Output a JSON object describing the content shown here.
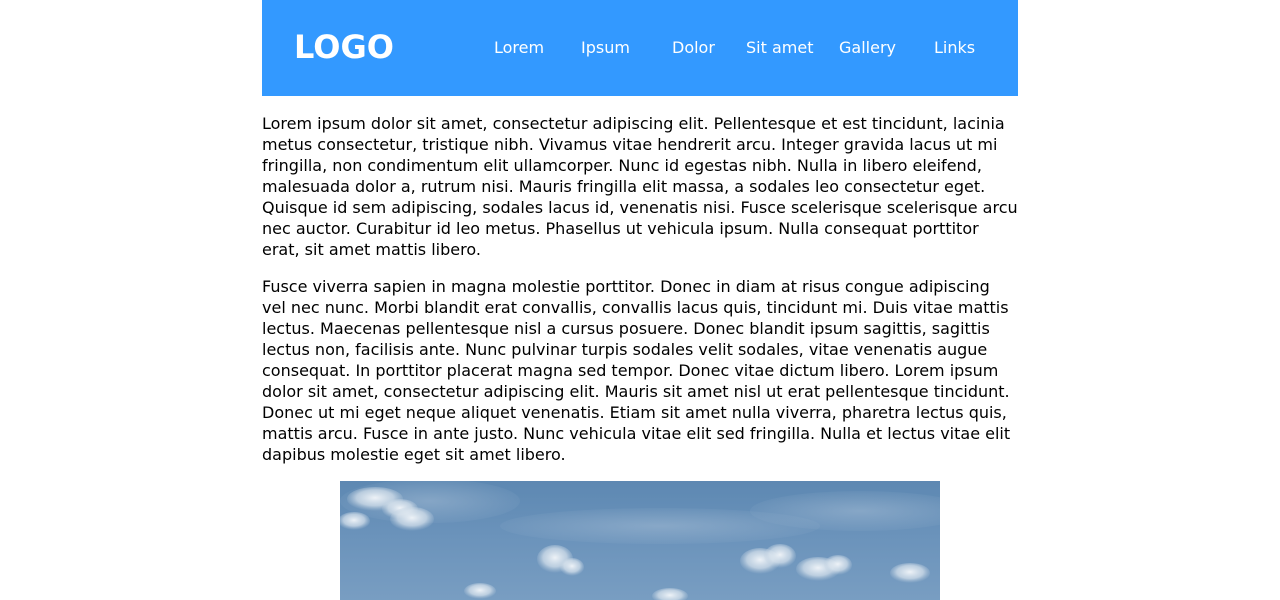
{
  "header": {
    "logo": "LOGO",
    "nav": [
      "Lorem",
      "Ipsum",
      "Dolor",
      "Sit amet",
      "Gallery",
      "Links"
    ]
  },
  "content": {
    "paragraphs": [
      "Lorem ipsum dolor sit amet, consectetur adipiscing elit. Pellentesque et est tincidunt, lacinia metus consectetur, tristique nibh. Vivamus vitae hendrerit arcu. Integer gravida lacus ut mi fringilla, non condimentum elit ullamcorper. Nunc id egestas nibh. Nulla in libero eleifend, malesuada dolor a, rutrum nisi. Mauris fringilla elit massa, a sodales leo consectetur eget. Quisque id sem adipiscing, sodales lacus id, venenatis nisi. Fusce scelerisque scelerisque arcu nec auctor. Curabitur id leo metus. Phasellus ut vehicula ipsum. Nulla consequat porttitor erat, sit amet mattis libero.",
      "Fusce viverra sapien in magna molestie porttitor. Donec in diam at risus congue adipiscing vel nec nunc. Morbi blandit erat convallis, convallis lacus quis, tincidunt mi. Duis vitae mattis lectus. Maecenas pellentesque nisl a cursus posuere. Donec blandit ipsum sagittis, sagittis lectus non, facilisis ante. Nunc pulvinar turpis sodales velit sodales, vitae venenatis augue consequat. In porttitor placerat magna sed tempor. Donec vitae dictum libero. Lorem ipsum dolor sit amet, consectetur adipiscing elit. Mauris sit amet nisl ut erat pellentesque tincidunt. Donec ut mi eget neque aliquet venenatis. Etiam sit amet nulla viverra, pharetra lectus quis, mattis arcu. Fusce in ante justo. Nunc vehicula vitae elit sed fringilla. Nulla et lectus vitae elit dapibus molestie eget sit amet libero."
    ]
  },
  "colors": {
    "header_bg": "#3399ff",
    "header_text": "#ffffff",
    "body_text": "#000000",
    "sky": "#6b93bb"
  }
}
